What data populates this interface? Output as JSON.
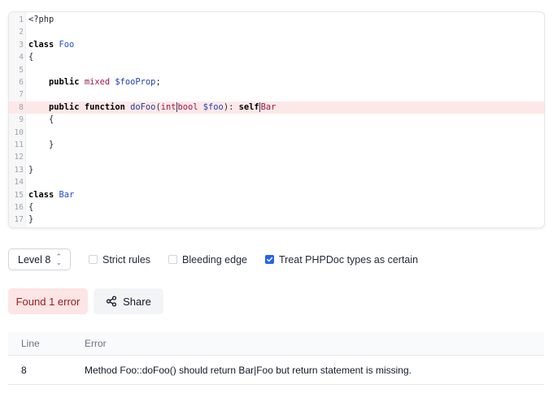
{
  "editor": {
    "lines": [
      {
        "n": "1",
        "tokens": [
          {
            "t": "<?php",
            "c": ""
          }
        ]
      },
      {
        "n": "2",
        "tokens": []
      },
      {
        "n": "3",
        "tokens": [
          {
            "t": "class",
            "c": "kw"
          },
          {
            "t": " ",
            "c": ""
          },
          {
            "t": "Foo",
            "c": "cls"
          }
        ]
      },
      {
        "n": "4",
        "tokens": [
          {
            "t": "{",
            "c": ""
          }
        ]
      },
      {
        "n": "5",
        "tokens": []
      },
      {
        "n": "6",
        "tokens": [
          {
            "t": "    ",
            "c": ""
          },
          {
            "t": "public",
            "c": "kw"
          },
          {
            "t": " ",
            "c": ""
          },
          {
            "t": "mixed",
            "c": "typ"
          },
          {
            "t": " ",
            "c": ""
          },
          {
            "t": "$fooProp",
            "c": "var"
          },
          {
            "t": ";",
            "c": ""
          }
        ]
      },
      {
        "n": "7",
        "tokens": []
      },
      {
        "n": "8",
        "hl": true,
        "tokens": [
          {
            "t": "    ",
            "c": ""
          },
          {
            "t": "public",
            "c": "kw"
          },
          {
            "t": " ",
            "c": ""
          },
          {
            "t": "function",
            "c": "kw"
          },
          {
            "t": " ",
            "c": ""
          },
          {
            "t": "doFoo",
            "c": "fn"
          },
          {
            "t": "(",
            "c": ""
          },
          {
            "t": "int",
            "c": "typ"
          },
          {
            "t": "|",
            "c": "cursor"
          },
          {
            "t": "bool",
            "c": "typ"
          },
          {
            "t": " ",
            "c": ""
          },
          {
            "t": "$foo",
            "c": "var"
          },
          {
            "t": "): ",
            "c": ""
          },
          {
            "t": "self",
            "c": "kw"
          },
          {
            "t": "|",
            "c": "cursor"
          },
          {
            "t": "Bar",
            "c": "typ"
          }
        ]
      },
      {
        "n": "9",
        "tokens": [
          {
            "t": "    {",
            "c": ""
          }
        ]
      },
      {
        "n": "10",
        "tokens": []
      },
      {
        "n": "11",
        "tokens": [
          {
            "t": "    }",
            "c": ""
          }
        ]
      },
      {
        "n": "12",
        "tokens": []
      },
      {
        "n": "13",
        "tokens": [
          {
            "t": "}",
            "c": ""
          }
        ]
      },
      {
        "n": "14",
        "tokens": []
      },
      {
        "n": "15",
        "tokens": [
          {
            "t": "class",
            "c": "kw"
          },
          {
            "t": " ",
            "c": ""
          },
          {
            "t": "Bar",
            "c": "cls"
          }
        ]
      },
      {
        "n": "16",
        "tokens": [
          {
            "t": "{",
            "c": ""
          }
        ]
      },
      {
        "n": "17",
        "tokens": [
          {
            "t": "}",
            "c": ""
          }
        ]
      }
    ]
  },
  "controls": {
    "level": "Level 8",
    "strict_rules": {
      "label": "Strict rules",
      "checked": false
    },
    "bleeding_edge": {
      "label": "Bleeding edge",
      "checked": false
    },
    "phpdoc_certain": {
      "label": "Treat PHPDoc types as certain",
      "checked": true
    }
  },
  "result": {
    "badge": "Found 1 error",
    "share_label": "Share"
  },
  "errors_table": {
    "headers": {
      "line": "Line",
      "error": "Error"
    },
    "rows": [
      {
        "line": "8",
        "message": "Method Foo::doFoo() should return Bar|Foo but return statement is missing."
      }
    ]
  },
  "colors": {
    "accent": "#2563eb",
    "error_bg": "#fde5e5",
    "error_text": "#991b1b",
    "highlight_line": "#fde8e8"
  },
  "icons": {
    "share": "share-icon",
    "level_chevron": "chevron-updown-icon",
    "check": "check-icon"
  }
}
